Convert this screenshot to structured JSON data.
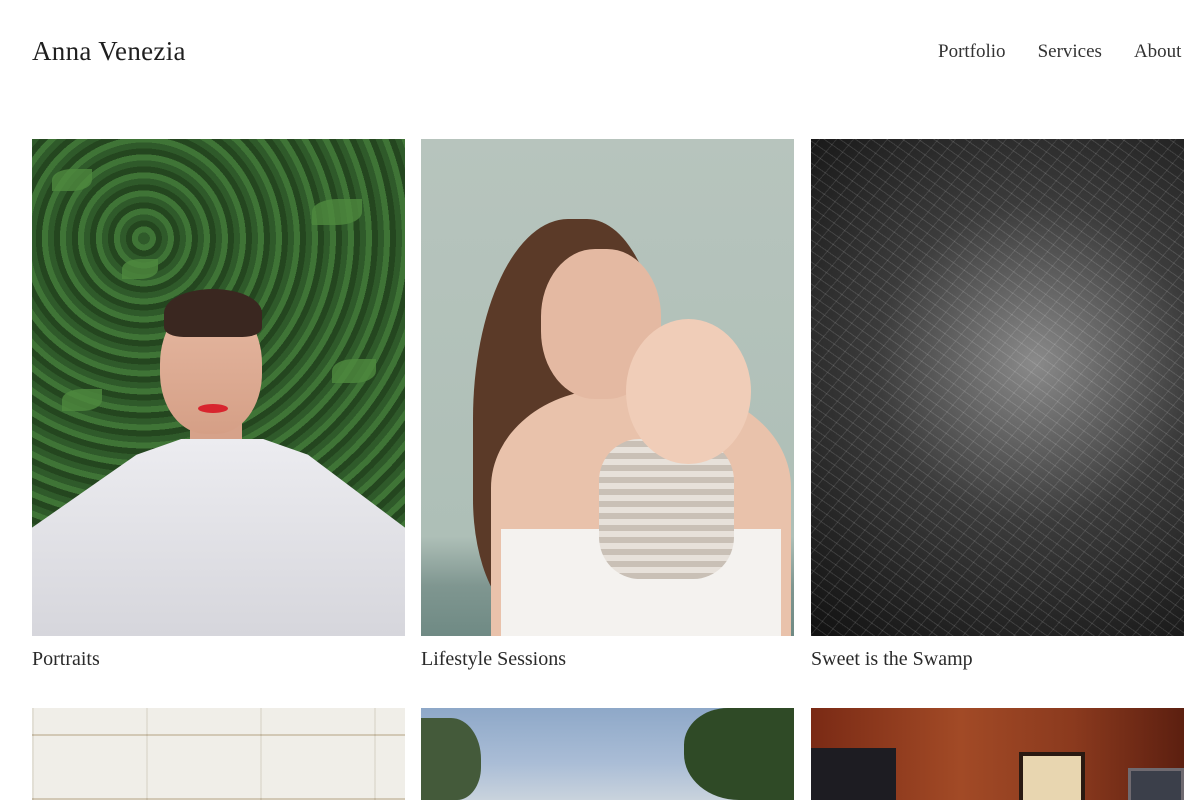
{
  "header": {
    "site_title": "Anna Venezia",
    "nav": [
      "Portfolio",
      "Services",
      "About"
    ]
  },
  "gallery": [
    {
      "caption": "Portraits",
      "icon": "portrait-photo-image"
    },
    {
      "caption": "Lifestyle Sessions",
      "icon": "mother-and-baby-photo-image"
    },
    {
      "caption": "Sweet is the Swamp",
      "icon": "black-and-white-foliage-photo-image"
    },
    {
      "caption": "",
      "icon": "white-tiles-photo-image"
    },
    {
      "caption": "",
      "icon": "trees-and-sky-photo-image"
    },
    {
      "caption": "",
      "icon": "wood-paneled-room-photo-image"
    }
  ]
}
